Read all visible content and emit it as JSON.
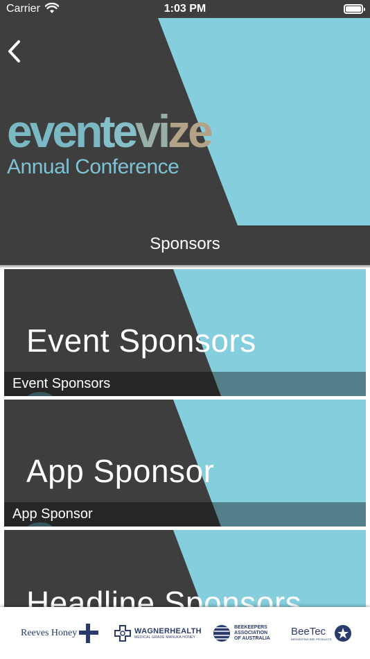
{
  "status_bar": {
    "carrier": "Carrier",
    "time": "1:03 PM"
  },
  "header": {
    "brand": {
      "part1": "even",
      "part2": "te",
      "part3": "vi",
      "part4": "ze",
      "subtitle": "Annual Conference"
    },
    "page_title": "Sponsors",
    "colors": {
      "dark": "#3e3e3e",
      "teal": "#85cede"
    }
  },
  "categories": [
    {
      "banner_text": "Event Sponsors",
      "caption": "Event Sponsors"
    },
    {
      "banner_text": "App Sponsor",
      "caption": "App Sponsor"
    },
    {
      "banner_text": "Headline Sponsors",
      "caption": ""
    }
  ],
  "footer_sponsors": [
    {
      "name": "Reeves Honey",
      "icon": "cross-icon"
    },
    {
      "name": "WAGNERHEALTH",
      "tagline": "MEDICAL GRADE MANUKA HONEY",
      "icon": "cross-outline-icon"
    },
    {
      "name": "BEEKEEPERS ASSOCIATION OF AUSTRALIA",
      "line1": "BEEKEEPERS",
      "line2": "ASSOCIATION",
      "line3": "OF AUSTRALIA",
      "icon": "globe-icon"
    },
    {
      "name": "BeeTec",
      "tagline": "BEEKEEPING BEE PRODUCTS",
      "icon": "star-badge-icon"
    }
  ]
}
